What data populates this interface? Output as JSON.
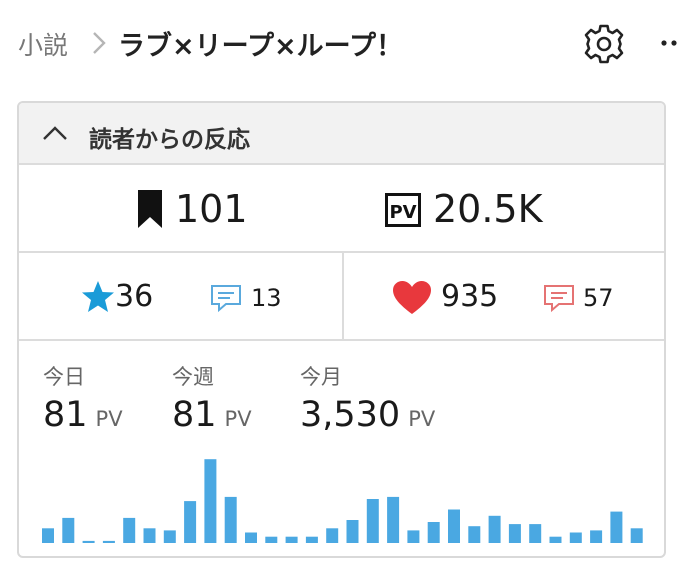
{
  "header": {
    "breadcrumb": "小説",
    "title": "ラブ×リープ×ループ！"
  },
  "panel": {
    "heading": "読者からの反応",
    "bookmarks": "101",
    "pageviews": "20.5K",
    "stars": "36",
    "star_comments": "13",
    "hearts": "935",
    "heart_comments": "57",
    "today_label": "今日",
    "today_value": "81",
    "week_label": "今週",
    "week_value": "81",
    "month_label": "今月",
    "month_value": "3,530",
    "unit": "PV"
  },
  "colors": {
    "star": "#1a9bd8",
    "comment_blue": "#5aa9dd",
    "heart": "#e8383d",
    "comment_red": "#e57373",
    "bar": "#4aa8e2"
  },
  "chart_data": {
    "type": "bar",
    "values": [
      7,
      12,
      1,
      1,
      12,
      7,
      6,
      20,
      40,
      22,
      5,
      3,
      3,
      3,
      7,
      11,
      21,
      22,
      6,
      10,
      16,
      8,
      13,
      9,
      9,
      3,
      5,
      6,
      15,
      7
    ],
    "ylim": [
      0,
      42
    ]
  }
}
